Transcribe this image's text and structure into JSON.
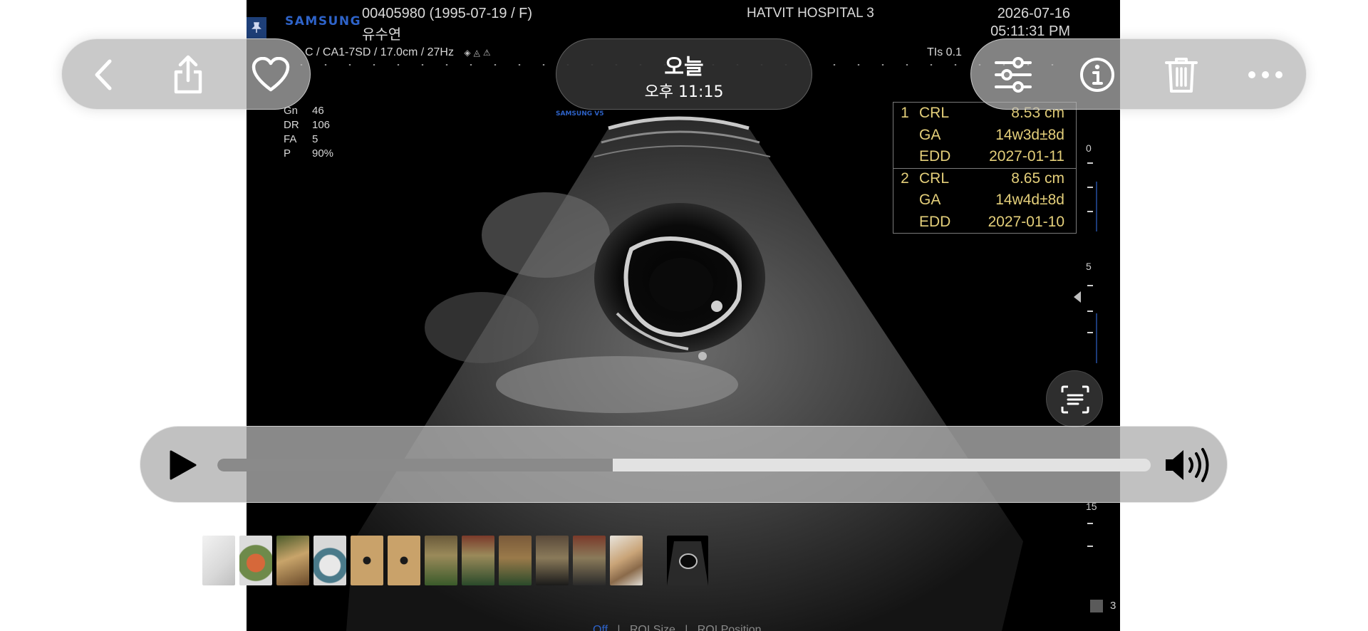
{
  "ultrasound": {
    "brand": "SAMSUNG",
    "patient_id": "00405980 (1995-07-19 / F)",
    "patient_name": "유수연",
    "hospital": "HATVIT HOSPITAL 3",
    "date": "2026-07-16",
    "time": "05:11:31 PM",
    "probe_info": "C / CA1-7SD / 17.0cm / 27Hz",
    "tis": "TIs  0.1",
    "logo_small": "SAMSUNG V5",
    "params": [
      {
        "k": "Gn",
        "v": "46"
      },
      {
        "k": "DR",
        "v": "106"
      },
      {
        "k": "FA",
        "v": "5"
      },
      {
        "k": "P",
        "v": "90%"
      }
    ],
    "measurements": [
      {
        "num": "1",
        "label": "CRL",
        "value": "8.53 cm"
      },
      {
        "num": "",
        "label": "GA",
        "value": "14w3d±8d"
      },
      {
        "num": "",
        "label": "EDD",
        "value": "2027-01-11"
      },
      {
        "num": "2",
        "label": "CRL",
        "value": "8.65 cm"
      },
      {
        "num": "",
        "label": "GA",
        "value": "14w4d±8d"
      },
      {
        "num": "",
        "label": "EDD",
        "value": "2027-01-10"
      }
    ],
    "depth_labels": [
      "0",
      "5",
      "15"
    ],
    "footer": {
      "off": "Off",
      "roi_size": "ROI Size",
      "roi_position": "ROI Position"
    },
    "page_counter": "3"
  },
  "top_bar": {
    "title": "오늘",
    "subtitle": "오후 11:15",
    "left_icons": [
      "back-icon",
      "share-icon",
      "heart-icon"
    ],
    "right_icons": [
      "adjust-icon",
      "info-icon",
      "trash-icon",
      "more-icon"
    ]
  },
  "player": {
    "progress": 0.424,
    "icons": [
      "play-icon",
      "volume-icon"
    ]
  },
  "filmstrip": {
    "count": 12
  },
  "colors": {
    "accent": "#2e63c9",
    "measurement": "#e4cf7a"
  }
}
